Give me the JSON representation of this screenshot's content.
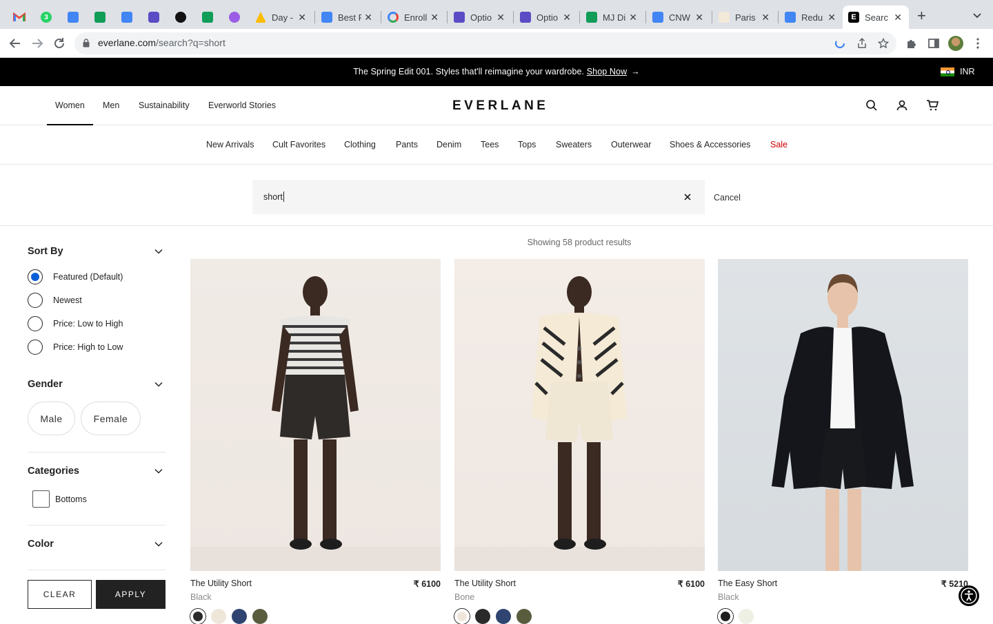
{
  "browser": {
    "tabs": [
      {
        "title": "Day -",
        "fav_color": "#34a853"
      },
      {
        "title": "Best F",
        "fav_color": "#4285f4"
      },
      {
        "title": "Enroll",
        "fav_color": "#ea4335"
      },
      {
        "title": "Optio",
        "fav_color": "#5b4bc4"
      },
      {
        "title": "Optio",
        "fav_color": "#5b4bc4"
      },
      {
        "title": "MJ Di",
        "fav_color": "#0f9d58"
      },
      {
        "title": "CNW",
        "fav_color": "#4285f4"
      },
      {
        "title": "Paris",
        "fav_color": "#c8a46a"
      },
      {
        "title": "Redu",
        "fav_color": "#4285f4"
      },
      {
        "title": "Searc",
        "fav_color": "#000000"
      }
    ],
    "pinned_tab_badge": "3",
    "url_host": "everlane.com",
    "url_path": "/search?q=short"
  },
  "promo": {
    "text": "The Spring Edit 001. Styles that'll reimagine your wardrobe.",
    "link": "Shop Now",
    "currency": "INR"
  },
  "header": {
    "nav": [
      "Women",
      "Men",
      "Sustainability",
      "Everworld Stories"
    ],
    "logo": "EVERLANE"
  },
  "categories": [
    "New Arrivals",
    "Cult Favorites",
    "Clothing",
    "Pants",
    "Denim",
    "Tees",
    "Tops",
    "Sweaters",
    "Outerwear",
    "Shoes & Accessories",
    "Sale"
  ],
  "search": {
    "value": "short",
    "cancel": "Cancel"
  },
  "filters": {
    "sort_title": "Sort By",
    "sort_options": [
      "Featured (Default)",
      "Newest",
      "Price: Low to High",
      "Price: High to Low"
    ],
    "gender_title": "Gender",
    "genders": [
      "Male",
      "Female"
    ],
    "categories_title": "Categories",
    "category_options": [
      "Bottoms"
    ],
    "color_title": "Color",
    "clear": "CLEAR",
    "apply": "APPLY"
  },
  "results": {
    "count_text": "Showing 58 product results",
    "products": [
      {
        "name": "The Utility Short",
        "price": "₹ 6100",
        "color": "Black",
        "swatches": [
          "#2a2a2a",
          "#efe6da",
          "#2f4470",
          "#5a5c3e"
        ]
      },
      {
        "name": "The Utility Short",
        "price": "₹ 6100",
        "color": "Bone",
        "swatches": [
          "#efe6da",
          "#2a2a2a",
          "#2f4470",
          "#5a5c3e"
        ]
      },
      {
        "name": "The Easy Short",
        "price": "₹ 5210",
        "color": "Black",
        "swatches": [
          "#1e1e1e",
          "#eef0e4"
        ]
      }
    ]
  },
  "colors": {
    "accent_blue": "#0b5fd6",
    "sale_red": "#cc0000",
    "promo_bg": "#000000"
  }
}
